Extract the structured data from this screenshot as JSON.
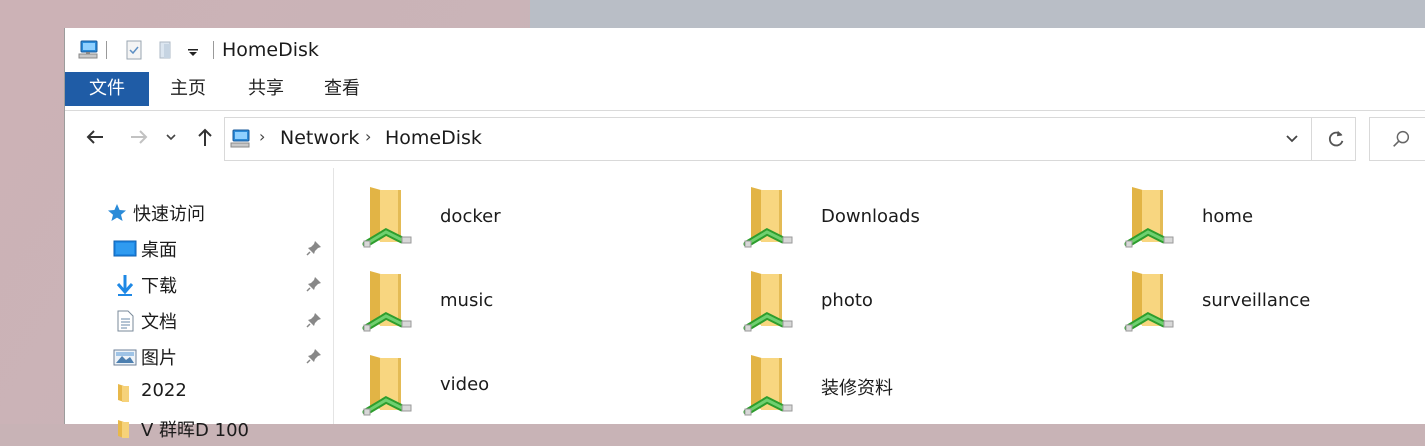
{
  "window": {
    "title": "HomeDisk"
  },
  "ribbon": {
    "tabs": [
      "文件",
      "主页",
      "共享",
      "查看"
    ]
  },
  "address": {
    "crumbs": [
      "Network",
      "HomeDisk"
    ]
  },
  "nav": {
    "quick_access": "快速访问",
    "items": [
      {
        "label": "桌面",
        "icon": "desktop-icon",
        "pinned": true
      },
      {
        "label": "下载",
        "icon": "download-icon",
        "pinned": true
      },
      {
        "label": "文档",
        "icon": "document-icon",
        "pinned": true
      },
      {
        "label": "图片",
        "icon": "picture-icon",
        "pinned": true
      },
      {
        "label": "2022",
        "icon": "folder-icon",
        "pinned": false
      },
      {
        "label": "V     群晖D  100",
        "icon": "folder-icon",
        "pinned": false
      }
    ]
  },
  "folders": [
    "docker",
    "Downloads",
    "home",
    "music",
    "photo",
    "surveillance",
    "video",
    "装修资料"
  ],
  "colors": {
    "accent": "#1f5ca6",
    "folder": "#f3d27a",
    "share": "#3cb43c"
  }
}
